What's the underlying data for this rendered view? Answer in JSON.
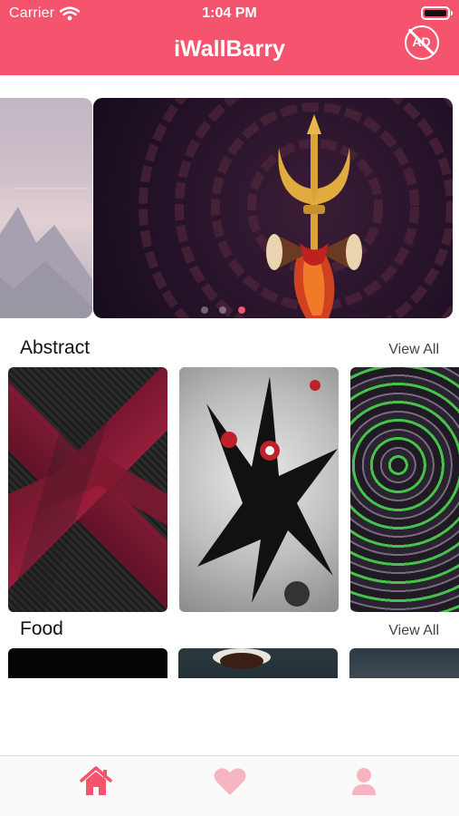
{
  "status_bar": {
    "carrier": "Carrier",
    "time": "1:04 PM",
    "battery_level": 1.0
  },
  "header": {
    "title": "iWallBarry",
    "no_ads_label": "AD",
    "background": "#f5546e"
  },
  "carousel": {
    "slide_count": 3,
    "active_index": 2,
    "accent": "#f5546e"
  },
  "sections": [
    {
      "title": "Abstract",
      "view_all": "View All",
      "thumbnails": [
        "abstract-red-cross-pattern",
        "abstract-ink-splash",
        "abstract-green-marble"
      ]
    },
    {
      "title": "Food",
      "view_all": "View All",
      "thumbnails": [
        "food-dark",
        "food-coffee-cup",
        "food-blue-grey"
      ]
    }
  ],
  "tabbar": {
    "items": [
      {
        "icon": "home-icon",
        "active": true
      },
      {
        "icon": "heart-icon",
        "active": false
      },
      {
        "icon": "profile-icon",
        "active": false
      }
    ],
    "active_color": "#f5546e",
    "inactive_color": "#f7b5c1"
  }
}
